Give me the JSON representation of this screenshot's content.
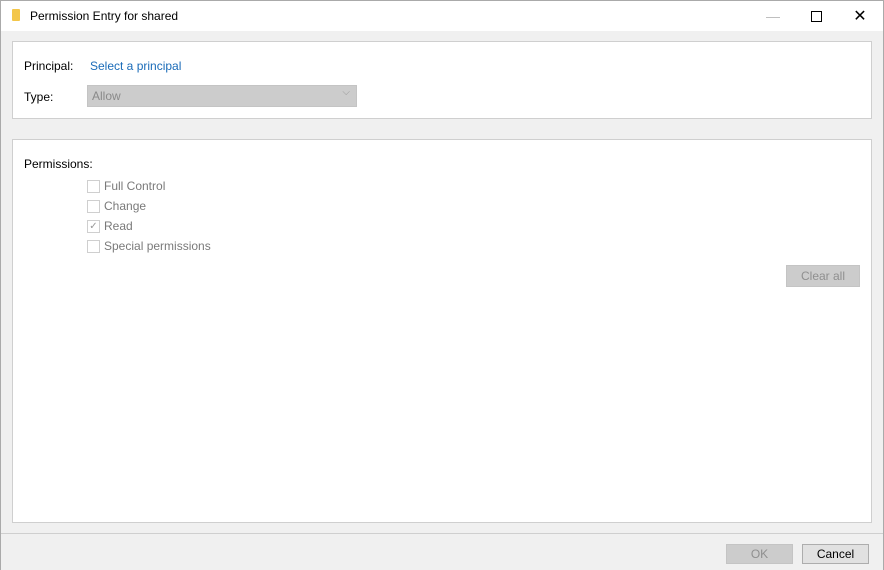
{
  "window": {
    "title": "Permission Entry for shared",
    "icon": "folder-icon",
    "controls": {
      "minimize": "minimize-icon",
      "maximize": "maximize-icon",
      "close": "close-icon",
      "close_glyph": "✕",
      "minimize_glyph": "—"
    }
  },
  "principal": {
    "label": "Principal:",
    "link": "Select a principal"
  },
  "type": {
    "label": "Type:",
    "value": "Allow",
    "chevron": "⌵"
  },
  "permissions": {
    "label": "Permissions:",
    "items": [
      {
        "label": "Full Control",
        "checked": false,
        "mark": ""
      },
      {
        "label": "Change",
        "checked": false,
        "mark": ""
      },
      {
        "label": "Read",
        "checked": true,
        "mark": "✓"
      },
      {
        "label": "Special permissions",
        "checked": false,
        "mark": ""
      }
    ],
    "clear_all": "Clear all"
  },
  "footer": {
    "ok": "OK",
    "cancel": "Cancel"
  }
}
